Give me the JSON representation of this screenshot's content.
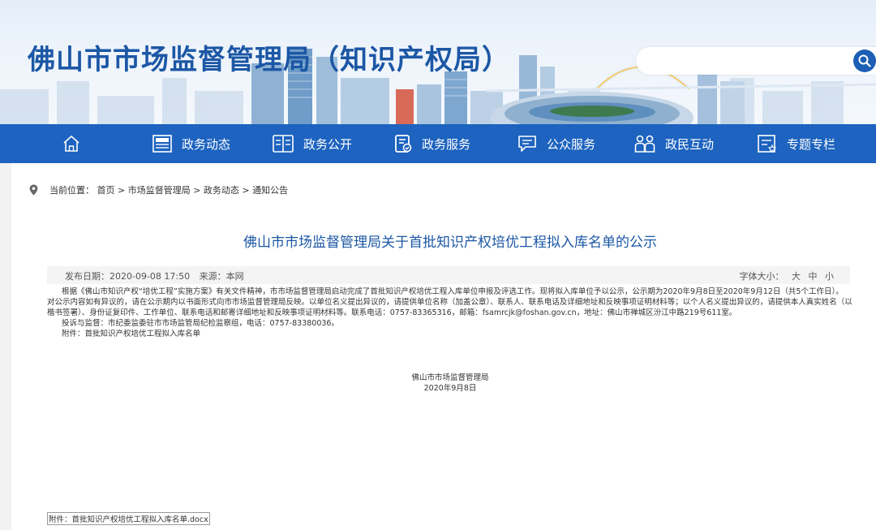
{
  "header": {
    "site_title": "佛山市市场监督管理局（知识产权局）",
    "search_placeholder": ""
  },
  "nav": {
    "items": [
      {
        "label": "",
        "icon": "home-icon"
      },
      {
        "label": "政务动态",
        "icon": "news-icon"
      },
      {
        "label": "政务公开",
        "icon": "book-icon"
      },
      {
        "label": "政务服务",
        "icon": "service-icon"
      },
      {
        "label": "公众服务",
        "icon": "chat-icon"
      },
      {
        "label": "政民互动",
        "icon": "people-icon"
      },
      {
        "label": "专题专栏",
        "icon": "topic-icon"
      }
    ]
  },
  "breadcrumb": {
    "text": "当前位置： 首页 > 市场监督管理局 > 政务动态 > 通知公告"
  },
  "article": {
    "title": "佛山市市场监督管理局关于首批知识产权培优工程拟入库名单的公示",
    "publish_date": "发布日期：2020-09-08 17:50",
    "source": "来源：本网",
    "font_size_label": "字体大小：",
    "font_large": "大",
    "font_medium": "中",
    "font_small": "小",
    "para1": "根据《佛山市知识产权“培优工程”实施方案》有关文件精神，市市场监督管理局启动完成了首批知识产权培优工程入库单位申报及评选工作。现将拟入库单位予以公示，公示期为2020年9月8日至2020年9月12日（共5个工作日）。",
    "para2": "对公示内容如有异议的，请在公示期内以书面形式向市市场监督管理局反映。以单位名义提出异议的，请提供单位名称（加盖公章）、联系人、联系电话及详细地址和反映事项证明材料等；以个人名义提出异议的，请提供本人真实姓名（以楷书签署）、身份证复印件、工作单位、联系电话和邮寄详细地址和反映事项证明材料等。联系电话：0757-83365316，邮箱：fsamrcjk@foshan.gov.cn，地址：佛山市禅城区汾江中路219号611室。",
    "para3": "投诉与监督：市纪委监委驻市市场监管局纪检监察组，电话：0757-83380036。",
    "para4": "附件：首批知识产权培优工程拟入库名单",
    "sign_org": "佛山市市场监督管理局",
    "sign_date": "2020年9月8日",
    "attachment_link": "附件：首批知识产权培优工程拟入库名单.docx"
  },
  "colors": {
    "brand_blue": "#1d63bf",
    "title_blue": "#1c57a5"
  }
}
